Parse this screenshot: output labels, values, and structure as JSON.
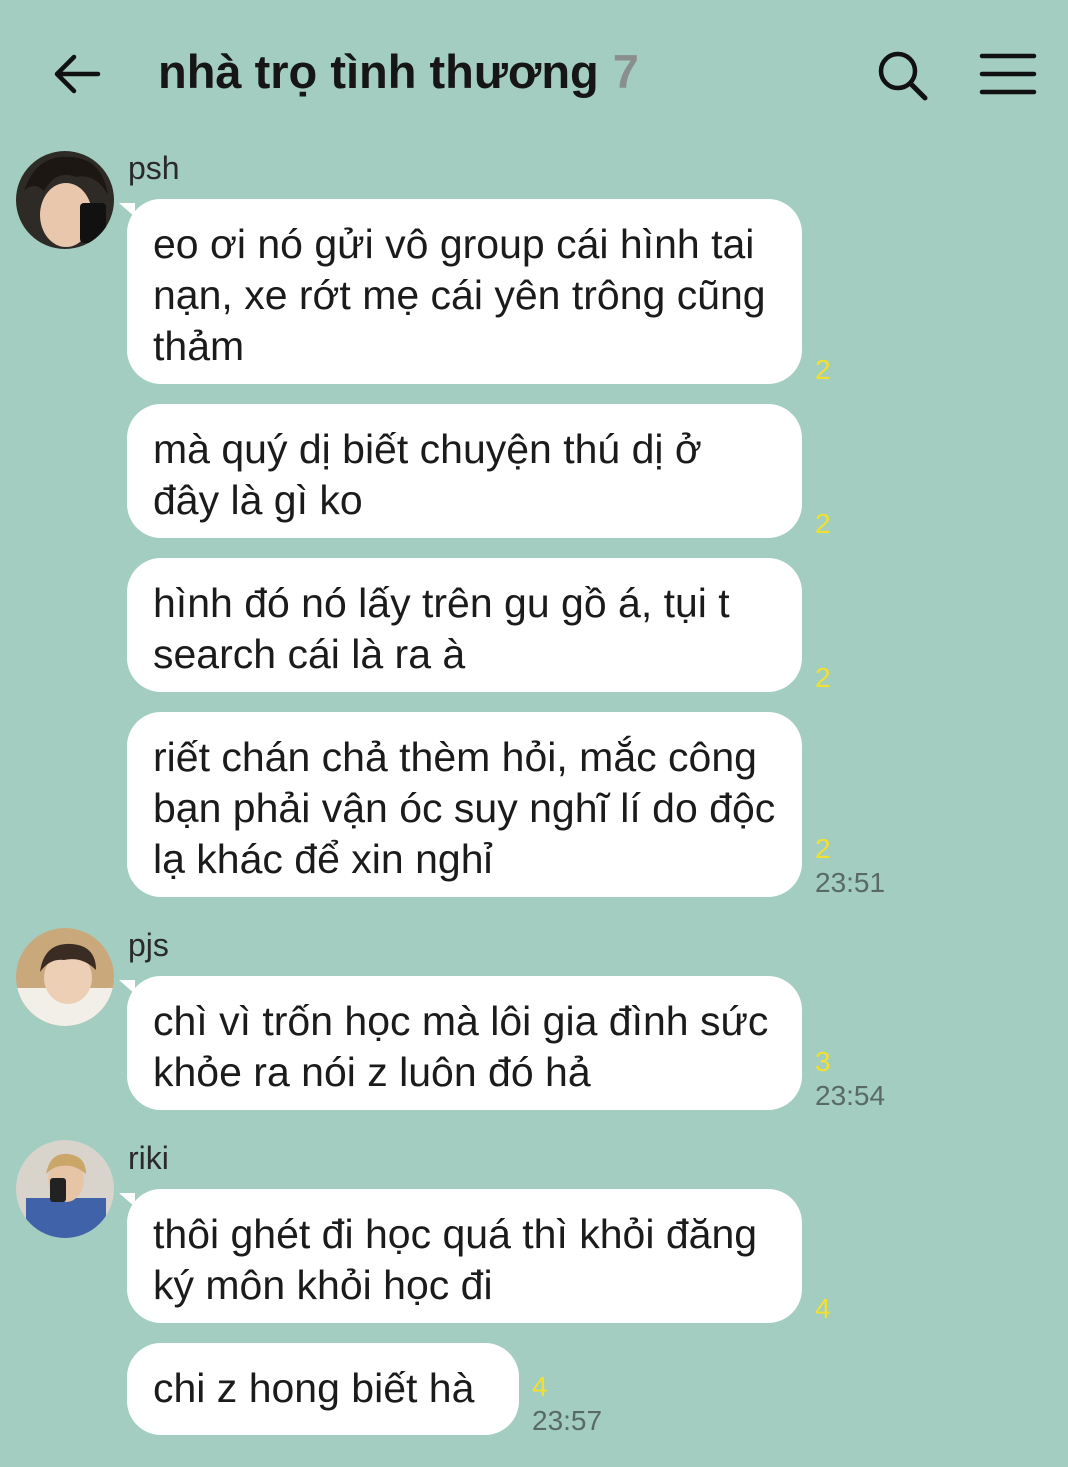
{
  "header": {
    "title": "nhà trọ tình thương",
    "member_count": "7",
    "back_icon": "arrow-left-icon",
    "search_icon": "search-icon",
    "menu_icon": "hamburger-menu-icon"
  },
  "colors": {
    "background": "#a3cdc1",
    "bubble": "#ffffff",
    "unread_count": "#f1e030",
    "timestamp": "#596a65"
  },
  "messages": [
    {
      "sender": "psh",
      "bubbles": [
        {
          "text": "eo ơi nó gửi vô group cái hình tai nạn, xe rớt mẹ cái yên trông cũng thảm",
          "unread": "2",
          "time": ""
        },
        {
          "text": "mà quý dị biết chuyện thú dị ở đây là gì ko",
          "unread": "2",
          "time": ""
        },
        {
          "text": "hình đó nó lấy trên gu gồ á, tụi t search cái là ra à",
          "unread": "2",
          "time": ""
        },
        {
          "text": "riết chán chả thèm hỏi, mắc công bạn phải vận óc suy nghĩ lí do độc lạ khác để xin nghỉ",
          "unread": "2",
          "time": "23:51"
        }
      ]
    },
    {
      "sender": "pjs",
      "bubbles": [
        {
          "text": "chì vì trốn học mà lôi gia đình sức khỏe ra nói z luôn đó hả",
          "unread": "3",
          "time": "23:54"
        }
      ]
    },
    {
      "sender": "riki",
      "bubbles": [
        {
          "text": "thôi ghét đi học quá thì khỏi đăng ký môn khỏi học đi",
          "unread": "4",
          "time": ""
        },
        {
          "text": "chi z hong biết hà",
          "unread": "4",
          "time": "23:57"
        }
      ]
    }
  ]
}
